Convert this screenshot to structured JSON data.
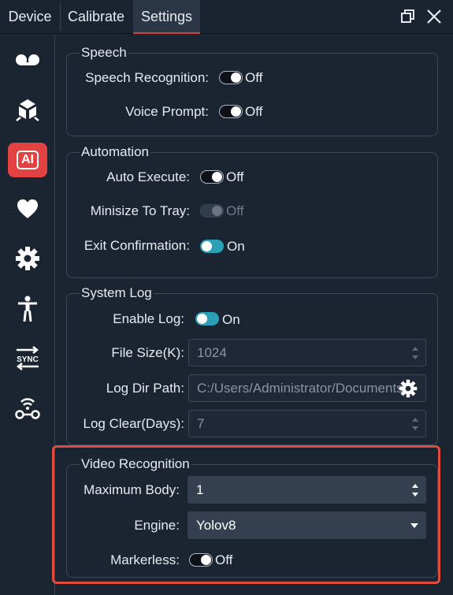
{
  "tabs": [
    {
      "label": "Device"
    },
    {
      "label": "Calibrate"
    },
    {
      "label": "Settings"
    }
  ],
  "sidebar": {
    "ai_label": "AI",
    "sync_label": "SYNC"
  },
  "speech": {
    "title": "Speech",
    "speech_recognition_label": "Speech Recognition:",
    "speech_recognition_state": "Off",
    "voice_prompt_label": "Voice Prompt:",
    "voice_prompt_state": "Off"
  },
  "automation": {
    "title": "Automation",
    "auto_execute_label": "Auto Execute:",
    "auto_execute_state": "Off",
    "minimize_label": "Minisize To Tray:",
    "minimize_state": "Off",
    "exit_confirm_label": "Exit Confirmation:",
    "exit_confirm_state": "On"
  },
  "system_log": {
    "title": "System Log",
    "enable_log_label": "Enable Log:",
    "enable_log_state": "On",
    "file_size_label": "File Size(K):",
    "file_size_value": "1024",
    "log_dir_label": "Log Dir Path:",
    "log_dir_value": "C:/Users/Administrator/Documents",
    "log_clear_label": "Log Clear(Days):",
    "log_clear_value": "7"
  },
  "video_recognition": {
    "title": "Video Recognition",
    "max_body_label": "Maximum Body:",
    "max_body_value": "1",
    "engine_label": "Engine:",
    "engine_value": "Yolov8",
    "markerless_label": "Markerless:",
    "markerless_state": "Off"
  },
  "colors": {
    "background": "#1b2431",
    "accent_red": "#e24242",
    "toggle_on": "#2a9fb5",
    "highlight": "#e04b40"
  }
}
